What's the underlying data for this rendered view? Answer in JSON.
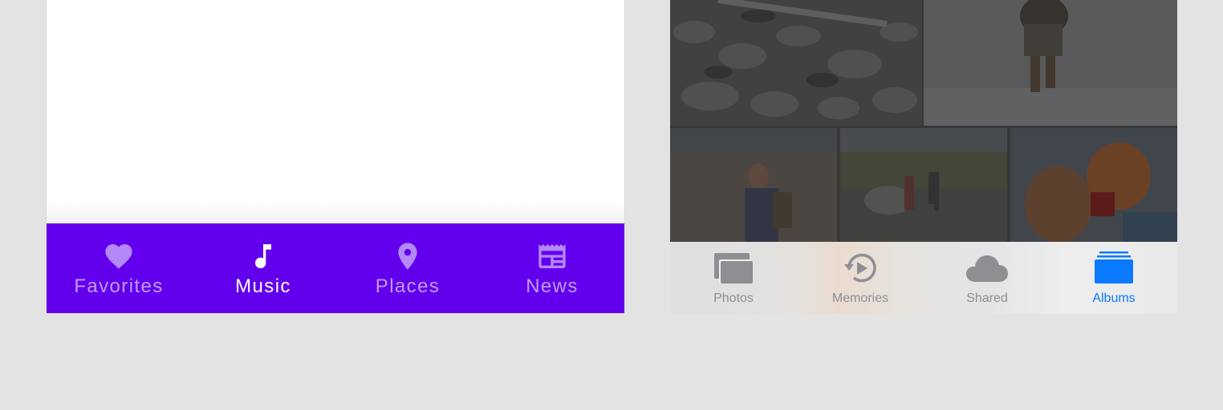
{
  "colors": {
    "android_nav_bg": "#6200ee",
    "android_active": "#ffffff",
    "android_inactive": "#b388f7",
    "ios_active": "#0a7aff",
    "ios_inactive": "#8e8e93"
  },
  "android": {
    "nav": [
      {
        "label": "Favorites",
        "icon": "heart-icon",
        "active": false
      },
      {
        "label": "Music",
        "icon": "music-note-icon",
        "active": true
      },
      {
        "label": "Places",
        "icon": "map-pin-icon",
        "active": false
      },
      {
        "label": "News",
        "icon": "newspaper-icon",
        "active": false
      }
    ]
  },
  "ios": {
    "tabs": [
      {
        "label": "Photos",
        "icon": "photos-stack-icon",
        "active": false
      },
      {
        "label": "Memories",
        "icon": "memories-replay-icon",
        "active": false
      },
      {
        "label": "Shared",
        "icon": "cloud-icon",
        "active": false
      },
      {
        "label": "Albums",
        "icon": "albums-folder-icon",
        "active": true
      }
    ]
  }
}
